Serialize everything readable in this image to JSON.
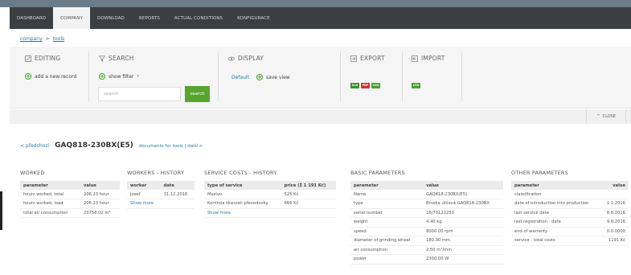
{
  "nav": {
    "items": [
      {
        "label": "DASHBOARD",
        "active": false
      },
      {
        "label": "COMPANY",
        "active": true
      },
      {
        "label": "DOWNLOAD",
        "active": false
      },
      {
        "label": "REPORTS",
        "active": false
      },
      {
        "label": "ACTUAL CONDITIONS",
        "active": false
      },
      {
        "label": "KONFIGURACE",
        "active": false
      }
    ]
  },
  "breadcrumb": {
    "root": "company",
    "separator": ">",
    "current": "tools"
  },
  "toolbar": {
    "editing": {
      "title": "EDITING",
      "add_label": "add a new record"
    },
    "search": {
      "title": "SEARCH",
      "filter_label": "show filter",
      "input_placeholder": "search",
      "button_label": "search"
    },
    "display": {
      "title": "DISPLAY",
      "default_label": "Default",
      "save_label": "save view"
    },
    "export": {
      "title": "EXPORT",
      "formats": [
        "XLS",
        "PDF",
        "CSV"
      ]
    },
    "import": {
      "title": "IMPORT",
      "formats": [
        "CSV"
      ]
    }
  },
  "close_label": "CLOSE",
  "tool": {
    "prev_label": "< předchozí",
    "name": "GAQ818-230BX(E5)",
    "docs_label": "documents for tools | další >"
  },
  "worked": {
    "title": "WORKED",
    "columns": [
      "parameter",
      "value"
    ],
    "rows": [
      [
        "hours worked, total",
        "206.23 hour"
      ],
      [
        "hours worked, load",
        "206.23 hour"
      ],
      [
        "total air consumption",
        "23758.02 m³"
      ]
    ]
  },
  "workers_history": {
    "title": "WORKERS - HISTORY",
    "columns": [
      "worker",
      "date"
    ],
    "rows": [
      [
        "Josef",
        "31.12.2016"
      ]
    ],
    "more_label": "Show more"
  },
  "service_costs": {
    "title": "SERVICE COSTS - HISTORY",
    "columns": [
      "type of service",
      "price (Σ 1 191 Kč)"
    ],
    "rows": [
      [
        "Mazivo",
        "525 Kč"
      ],
      [
        "Kontrola těsnosti převodovky",
        "666 Kč"
      ]
    ],
    "more_label": "Show more"
  },
  "basic_params": {
    "title": "BASIC PARAMETERS",
    "columns": [
      "parameter",
      "value"
    ],
    "rows": [
      [
        "Name",
        "GAQ818-230BX(E5)"
      ],
      [
        "type",
        "Bruska úhlová GAQ818-230BX"
      ],
      [
        "serial number",
        "16/70122250"
      ],
      [
        "weight",
        "4.40 kg"
      ],
      [
        "speed",
        "8000.00 rpm"
      ],
      [
        "diameter of grinding wheel",
        "180.00 mm"
      ],
      [
        "air consumption",
        "2.50 m³/min"
      ],
      [
        "power",
        "2300.00 W"
      ]
    ]
  },
  "other_params": {
    "title": "OTHER PARAMETERS",
    "columns": [
      "parameter",
      "value"
    ],
    "rows": [
      [
        "classification",
        ""
      ],
      [
        "date of introduction into production",
        "1.1.2016"
      ],
      [
        "last service date",
        "8.6.2016"
      ],
      [
        "last registration - date",
        "9.6.2016"
      ],
      [
        "end of warranty",
        "0.0.0000"
      ],
      [
        "service - total costs",
        "1191 Kč"
      ]
    ]
  },
  "colors": {
    "accent_green": "#58a52e",
    "link_blue": "#1f79a8",
    "nav_bg": "#3c3f41",
    "xls": "#3c8f2f",
    "pdf": "#d0342c",
    "csv": "#4aa02c"
  }
}
